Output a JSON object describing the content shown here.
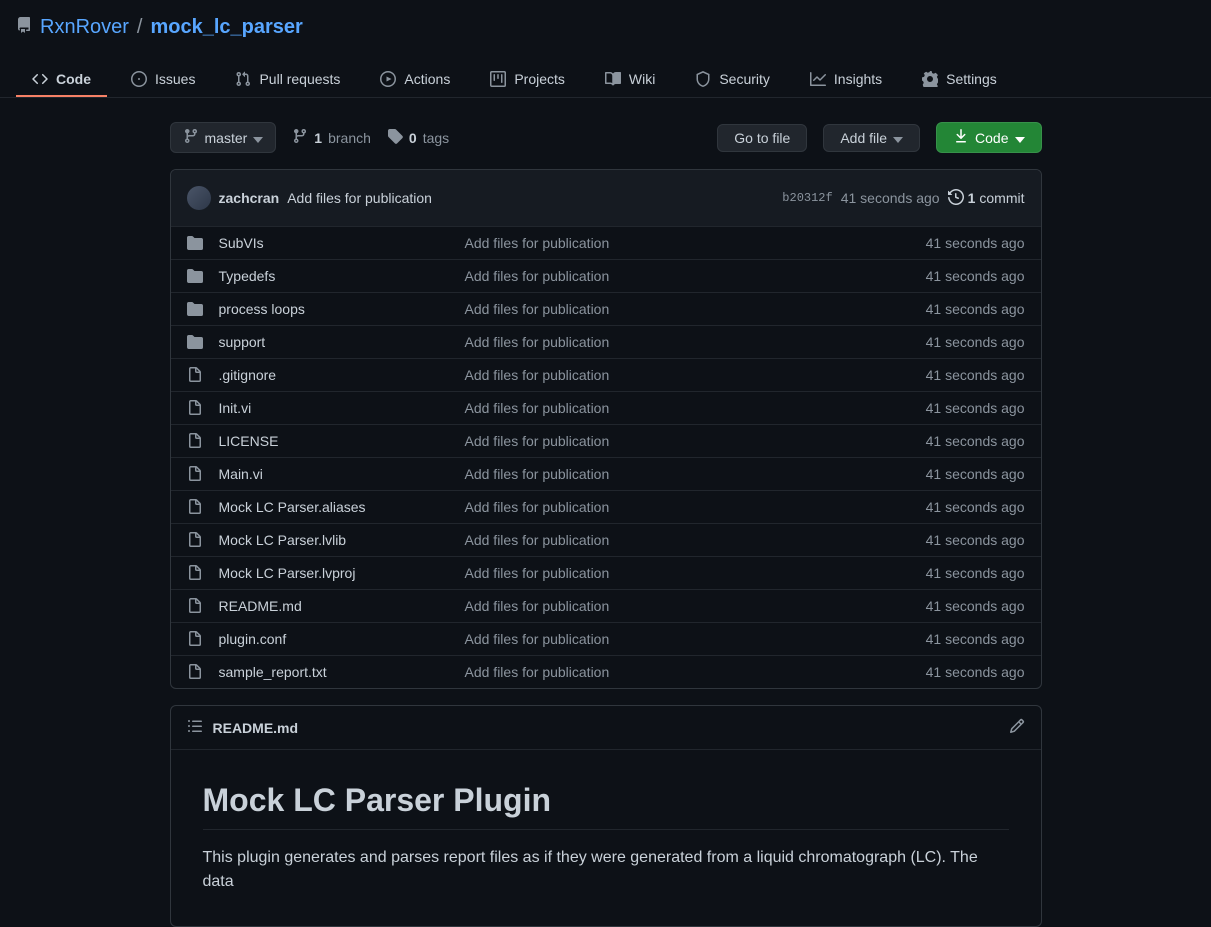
{
  "repo": {
    "owner": "RxnRover",
    "name": "mock_lc_parser",
    "separator": "/"
  },
  "nav": {
    "code": "Code",
    "issues": "Issues",
    "pulls": "Pull requests",
    "actions": "Actions",
    "projects": "Projects",
    "wiki": "Wiki",
    "security": "Security",
    "insights": "Insights",
    "settings": "Settings"
  },
  "branch": {
    "current": "master",
    "count": "1",
    "label": "branch"
  },
  "tags": {
    "count": "0",
    "label": "tags"
  },
  "actions": {
    "go_to_file": "Go to file",
    "add_file": "Add file",
    "code": "Code"
  },
  "latest_commit": {
    "author": "zachcran",
    "message": "Add files for publication",
    "hash": "b20312f",
    "time": "41 seconds ago",
    "commits_count": "1",
    "commits_label": "commit"
  },
  "files": [
    {
      "type": "dir",
      "name": "SubVIs",
      "msg": "Add files for publication",
      "time": "41 seconds ago"
    },
    {
      "type": "dir",
      "name": "Typedefs",
      "msg": "Add files for publication",
      "time": "41 seconds ago"
    },
    {
      "type": "dir",
      "name": "process loops",
      "msg": "Add files for publication",
      "time": "41 seconds ago"
    },
    {
      "type": "dir",
      "name": "support",
      "msg": "Add files for publication",
      "time": "41 seconds ago"
    },
    {
      "type": "file",
      "name": ".gitignore",
      "msg": "Add files for publication",
      "time": "41 seconds ago"
    },
    {
      "type": "file",
      "name": "Init.vi",
      "msg": "Add files for publication",
      "time": "41 seconds ago"
    },
    {
      "type": "file",
      "name": "LICENSE",
      "msg": "Add files for publication",
      "time": "41 seconds ago"
    },
    {
      "type": "file",
      "name": "Main.vi",
      "msg": "Add files for publication",
      "time": "41 seconds ago"
    },
    {
      "type": "file",
      "name": "Mock LC Parser.aliases",
      "msg": "Add files for publication",
      "time": "41 seconds ago"
    },
    {
      "type": "file",
      "name": "Mock LC Parser.lvlib",
      "msg": "Add files for publication",
      "time": "41 seconds ago"
    },
    {
      "type": "file",
      "name": "Mock LC Parser.lvproj",
      "msg": "Add files for publication",
      "time": "41 seconds ago"
    },
    {
      "type": "file",
      "name": "README.md",
      "msg": "Add files for publication",
      "time": "41 seconds ago"
    },
    {
      "type": "file",
      "name": "plugin.conf",
      "msg": "Add files for publication",
      "time": "41 seconds ago"
    },
    {
      "type": "file",
      "name": "sample_report.txt",
      "msg": "Add files for publication",
      "time": "41 seconds ago"
    }
  ],
  "readme": {
    "filename": "README.md",
    "heading": "Mock LC Parser Plugin",
    "body": "This plugin generates and parses report files as if they were generated from a liquid chromatograph (LC). The data"
  }
}
